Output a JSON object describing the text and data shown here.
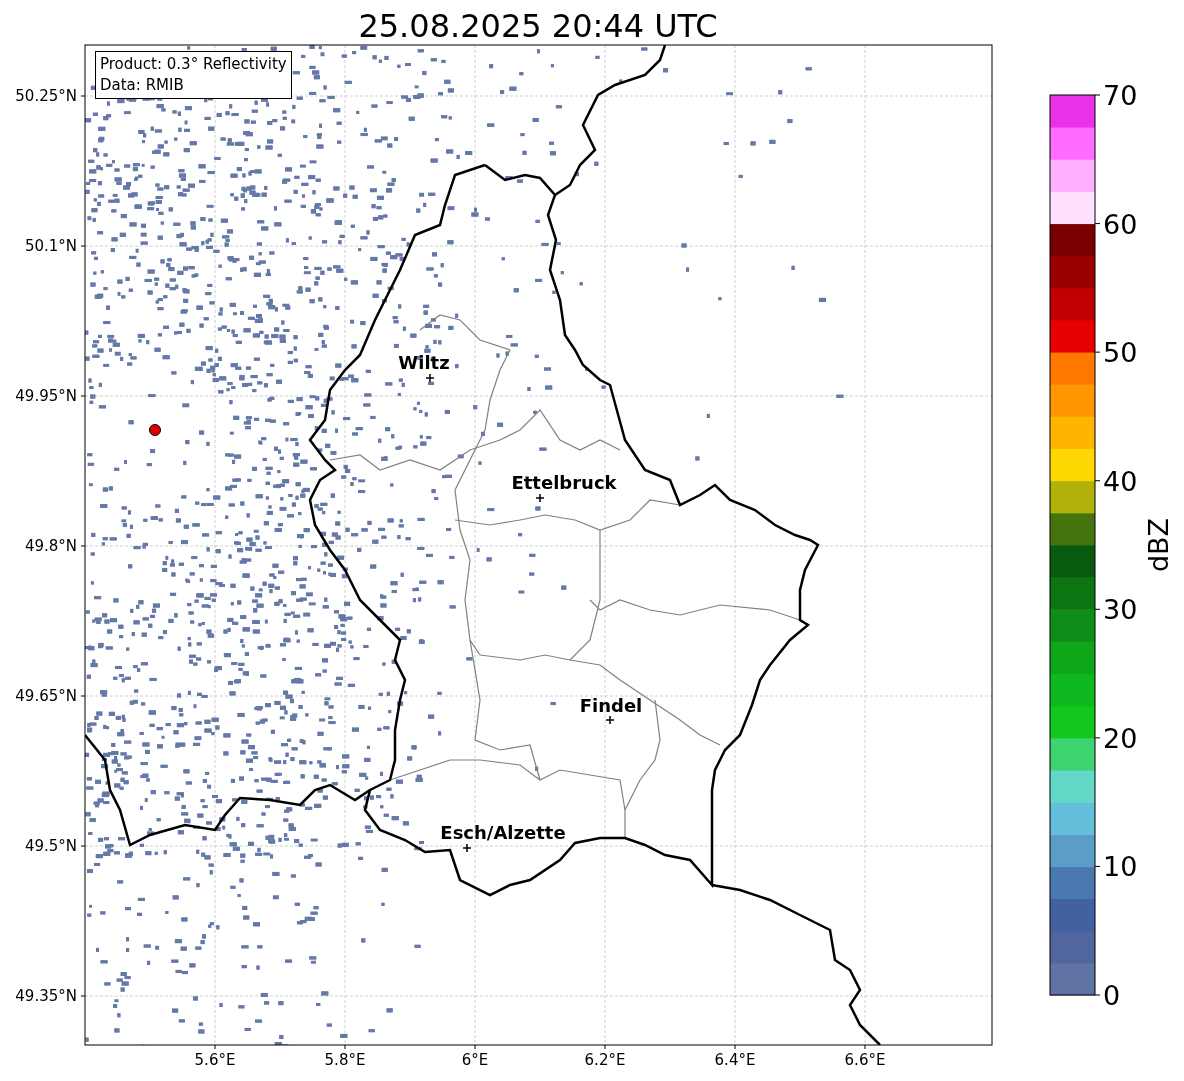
{
  "title": "25.08.2025 20:44 UTC",
  "info_box": [
    "Product: 0.3° Reflectivity",
    "Data: RMIB"
  ],
  "map": {
    "x_ticks": [
      "5.6°E",
      "5.8°E",
      "6°E",
      "6.2°E",
      "6.4°E",
      "6.6°E"
    ],
    "y_ticks": [
      "50.25°N",
      "50.1°N",
      "49.95°N",
      "49.8°N",
      "49.65°N",
      "49.5°N",
      "49.35°N"
    ],
    "cities": [
      {
        "name": "Wiltz"
      },
      {
        "name": "Ettelbruck"
      },
      {
        "name": "Findel"
      },
      {
        "name": "Esch/Alzette"
      }
    ]
  },
  "colorbar": {
    "label": "dBZ",
    "ticks": [
      "70",
      "60",
      "50",
      "40",
      "30",
      "20",
      "10",
      "0"
    ],
    "bands": [
      {
        "color": "#6073a5"
      },
      {
        "color": "#51659e"
      },
      {
        "color": "#4360a0"
      },
      {
        "color": "#4a78b0"
      },
      {
        "color": "#5a9ec8"
      },
      {
        "color": "#63bfdc"
      },
      {
        "color": "#62d8c8"
      },
      {
        "color": "#3dd470"
      },
      {
        "color": "#12c81f"
      },
      {
        "color": "#10b820"
      },
      {
        "color": "#0fa61a"
      },
      {
        "color": "#0e8d18"
      },
      {
        "color": "#0c7512"
      },
      {
        "color": "#075a0e"
      },
      {
        "color": "#45740e"
      },
      {
        "color": "#b0b20a"
      },
      {
        "color": "#ffd700"
      },
      {
        "color": "#ffb400"
      },
      {
        "color": "#ff9800"
      },
      {
        "color": "#ff7800"
      },
      {
        "color": "#e60000"
      },
      {
        "color": "#c00000"
      },
      {
        "color": "#9a0000"
      },
      {
        "color": "#780000"
      },
      {
        "color": "#ffe0ff"
      },
      {
        "color": "#ffb0ff"
      },
      {
        "color": "#ff6cff"
      },
      {
        "color": "#e832e8"
      }
    ]
  }
}
